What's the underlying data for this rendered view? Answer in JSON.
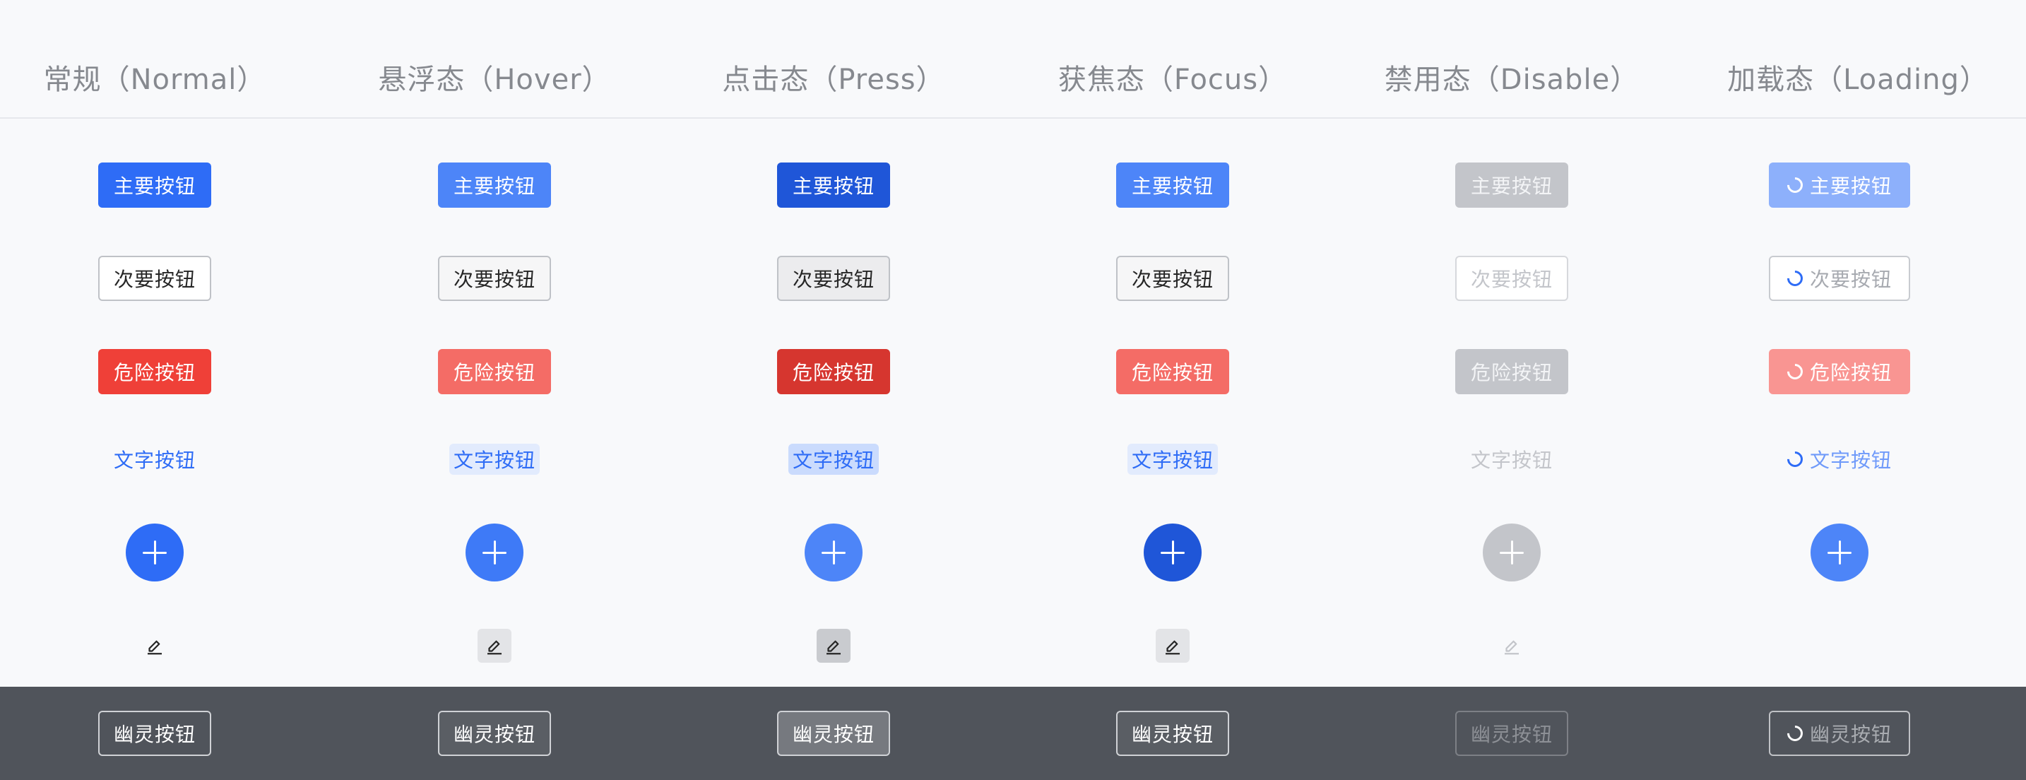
{
  "columns": [
    "常规（Normal）",
    "悬浮态（Hover）",
    "点击态（Press）",
    "获焦态（Focus）",
    "禁用态（Disable）",
    "加载态（Loading）"
  ],
  "labels": {
    "primary": "主要按钮",
    "secondary": "次要按钮",
    "danger": "危险按钮",
    "text": "文字按钮",
    "ghost": "幽灵按钮"
  },
  "icons": {
    "fab": "plus-icon",
    "icon_button": "edit-pencil-icon",
    "loading": "spinner-icon"
  },
  "colors": {
    "primary": "#2e6cf6",
    "danger": "#ef4038",
    "disabled": "#c3c5ca",
    "dark_band": "#50545b"
  }
}
